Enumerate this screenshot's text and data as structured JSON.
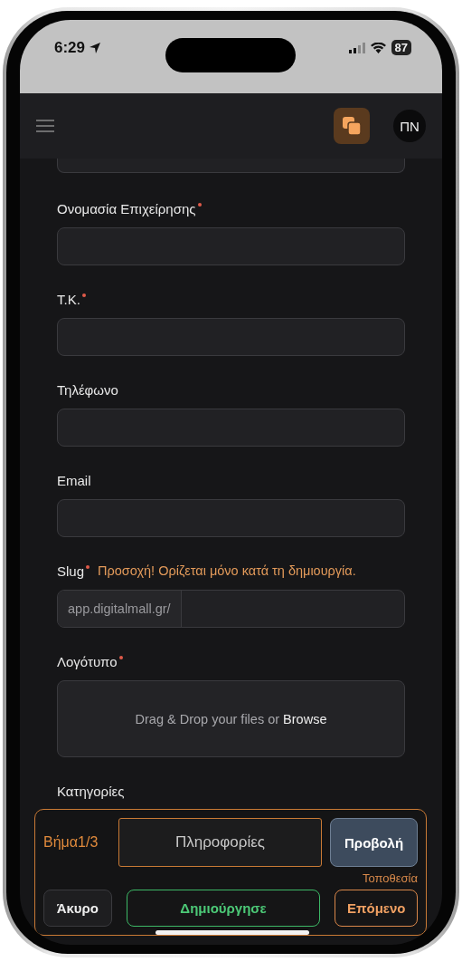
{
  "status_bar": {
    "time": "6:29",
    "battery": "87"
  },
  "header": {
    "avatar": "ΠΝ"
  },
  "fields": [
    {
      "kind": "text"
    },
    {
      "kind": "text",
      "label": "Ονομασία Επιχείρησης",
      "required": true
    },
    {
      "kind": "text",
      "label": "Τ.Κ.",
      "required": true
    },
    {
      "kind": "text",
      "label": "Τηλέφωνο",
      "required": false
    },
    {
      "kind": "text",
      "label": "Email",
      "required": false
    },
    {
      "kind": "prefixed",
      "label": "Slug",
      "required": true,
      "note": "Προσοχή! Ορίζεται μόνο κατά τη δημιουργία.",
      "prefix": "app.digitalmall.gr/"
    },
    {
      "kind": "upload",
      "label": "Λογότυπο",
      "required": true,
      "text": "Drag & Drop your files or **Browse**"
    },
    {
      "kind": "select",
      "label": "Κατηγορίες",
      "required": false
    }
  ],
  "step_panel": {
    "step_label": "Βήμα",
    "step": "1/3",
    "step_title": "Πληροφορίες",
    "preview_button": "Προβολή",
    "next_step_name": "Τοποθεσία",
    "buttons": [
      {
        "label": "Άκυρο",
        "kind": "cancel"
      },
      {
        "label": "Δημιούργησε",
        "kind": "create"
      },
      {
        "label": "Επόμενο",
        "kind": "next"
      }
    ]
  }
}
